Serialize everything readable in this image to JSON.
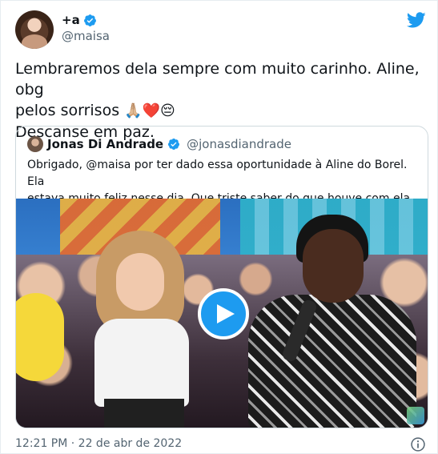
{
  "author": {
    "display_name": "+a",
    "handle": "@maisa",
    "verified": true
  },
  "tweet": {
    "line1": "Lembraremos dela sempre com muito carinho. Aline, obg",
    "line2_text": "pelos sorrisos",
    "line2_emoji": "🙏🏼❤️😔",
    "line3": "Descanse em paz."
  },
  "quote": {
    "display_name": "Jonas Di Andrade",
    "handle": "@jonasdiandrade",
    "verified": true,
    "text_line1": "Obrigado, @maisa por ter dado essa oportunidade à Aline do Borel. Ela",
    "text_line2": "estava muito feliz nesse dia. Que triste saber do que houve com ela 😔"
  },
  "meta": {
    "timestamp": "12:21 PM · 22 de abr de 2022"
  },
  "icons": {
    "brand": "twitter-bird-icon",
    "verified": "verified-badge-icon",
    "play": "play-icon",
    "info": "info-icon"
  },
  "colors": {
    "accent": "#1d9bf0",
    "text_primary": "#0f1419",
    "text_secondary": "#536471",
    "border": "#cfd9de"
  }
}
